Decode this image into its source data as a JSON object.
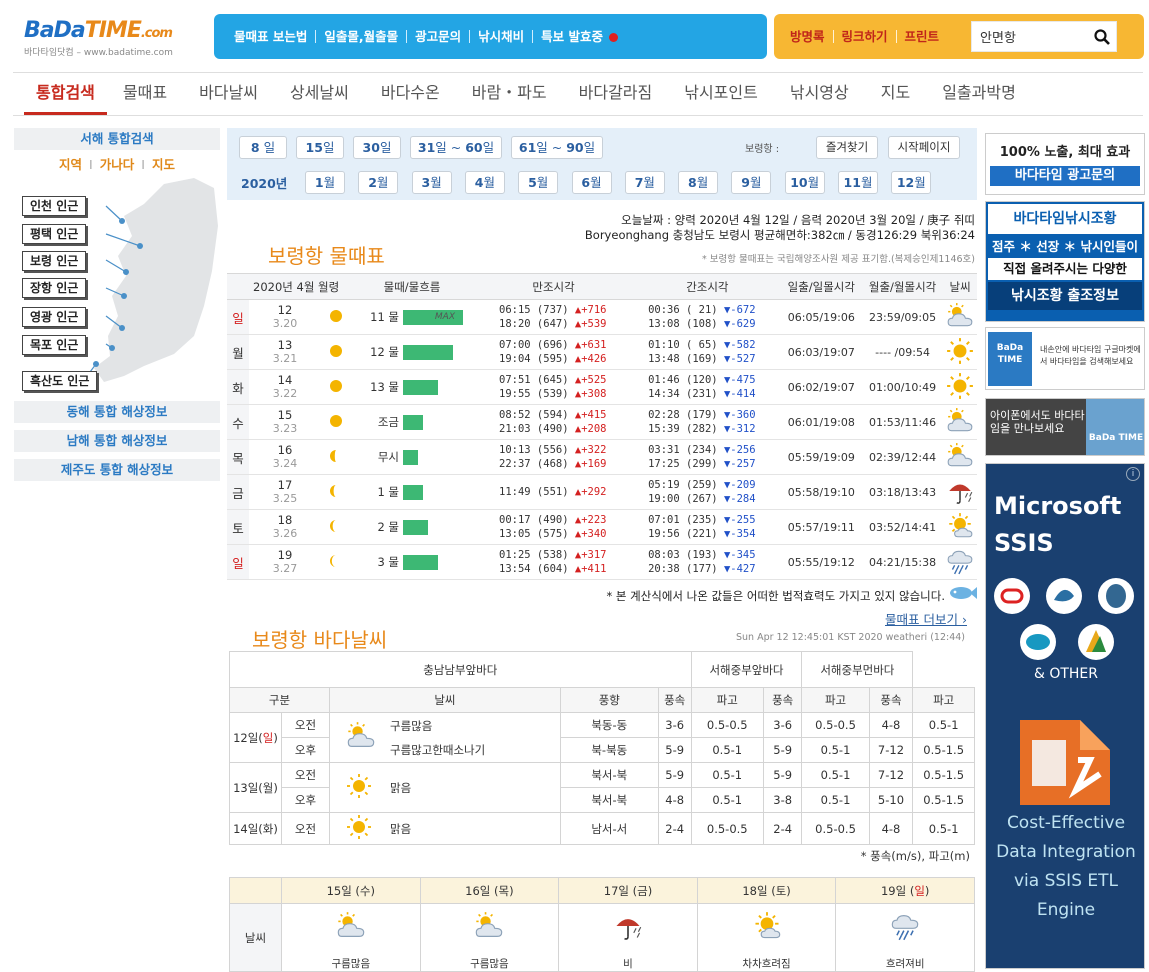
{
  "header": {
    "logo_main": "BaDa",
    "logo_time": "TIME",
    "logo_com": ".com",
    "logo_sub": "바다타임닷컴 – www.badatime.com",
    "topnav": [
      "물때표 보는법",
      "일출몰,월출몰",
      "광고문의",
      "낚시채비",
      "특보 발효중"
    ],
    "topright": [
      "방명록",
      "링크하기",
      "프린트"
    ],
    "search_value": "안면항"
  },
  "tabs": [
    "통합검색",
    "물때표",
    "바다날씨",
    "상세날씨",
    "바다수온",
    "바람・파도",
    "바다갈라짐",
    "낚시포인트",
    "낚시영상",
    "지도",
    "일출과박명"
  ],
  "sidebar": {
    "head": "서해 통합검색",
    "sub": [
      "지역",
      "가나다",
      "지도"
    ],
    "regions": [
      "인천 인근",
      "평택 인근",
      "보령 인근",
      "장항 인근",
      "영광 인근",
      "목포 인근",
      "흑산도 인근"
    ],
    "buttons": [
      "동해 통합 해상정보",
      "남해 통합 해상정보",
      "제주도 통합 해상정보"
    ]
  },
  "datebar": {
    "ranges": [
      {
        "n": "8",
        "u": " 일"
      },
      {
        "n": "15",
        "u": "일"
      },
      {
        "n": "30",
        "u": "일"
      },
      {
        "n": "31",
        "u": "일 ~ ",
        "n2": "60",
        "u2": "일"
      },
      {
        "n": "61",
        "u": "일 ~ ",
        "n2": "90",
        "u2": "일"
      }
    ],
    "label": "보령항 :",
    "fav": "즐겨찾기",
    "start": "시작페이지",
    "year": "2020년",
    "months": [
      "1",
      "2",
      "3",
      "4",
      "5",
      "6",
      "7",
      "8",
      "9",
      "10",
      "11",
      "12"
    ],
    "month_unit": "월"
  },
  "today": {
    "line1": "오늘날짜 : 양력 2020년 4월 12일 / 음력 2020년 3월 20일 / 庚子 쥐띠",
    "line2": "Boryeonghang 충청남도 보령시 평균해면하:382㎝ / 동경126:29 북위36:24",
    "source": "* 보령항 물때표는 국립해양조사원 제공 표기함.(복제승인제1146호)"
  },
  "tide": {
    "title": "보령항 물때표",
    "headers": [
      "2020년  4월 월령",
      "물때/물흐름",
      "만조시각",
      "간조시각",
      "일출/일몰시각",
      "월출/월몰시각",
      "날씨"
    ],
    "rows": [
      {
        "dow": "일",
        "d": "12",
        "l": "3.20",
        "mul": "11 물",
        "bar": 0.86,
        "max": "MAX",
        "hi": [
          [
            "06:15 (737)",
            "+716"
          ],
          [
            "18:20 (647)",
            "+539"
          ]
        ],
        "lo": [
          [
            "00:36 ( 21)",
            "-672"
          ],
          [
            "13:08 (108)",
            "-629"
          ]
        ],
        "sun": "06:05/19:06",
        "moon": "23:59/09:05",
        "w": "cloudy"
      },
      {
        "dow": "월",
        "d": "13",
        "l": "3.21",
        "mul": "12 물",
        "bar": 0.71,
        "hi": [
          [
            "07:00 (696)",
            "+631"
          ],
          [
            "19:04 (595)",
            "+426"
          ]
        ],
        "lo": [
          [
            "01:10 ( 65)",
            "-582"
          ],
          [
            "13:48 (169)",
            "-527"
          ]
        ],
        "sun": "06:03/19:07",
        "moon": "---- /09:54",
        "w": "sun"
      },
      {
        "dow": "화",
        "d": "14",
        "l": "3.22",
        "mul": "13 물",
        "bar": 0.5,
        "hi": [
          [
            "07:51 (645)",
            "+525"
          ],
          [
            "19:55 (539)",
            "+308"
          ]
        ],
        "lo": [
          [
            "01:46 (120)",
            "-475"
          ],
          [
            "14:34 (231)",
            "-414"
          ]
        ],
        "sun": "06:02/19:07",
        "moon": "01:00/10:49",
        "w": "sun"
      },
      {
        "dow": "수",
        "d": "15",
        "l": "3.23",
        "mul": "조금",
        "bar": 0.29,
        "hi": [
          [
            "08:52 (594)",
            "+415"
          ],
          [
            "21:03 (490)",
            "+208"
          ]
        ],
        "lo": [
          [
            "02:28 (179)",
            "-360"
          ],
          [
            "15:39 (282)",
            "-312"
          ]
        ],
        "sun": "06:01/19:08",
        "moon": "01:53/11:46",
        "w": "cloudy"
      },
      {
        "dow": "목",
        "d": "16",
        "l": "3.24",
        "mul": "무시",
        "bar": 0.21,
        "hi": [
          [
            "10:13 (556)",
            "+322"
          ],
          [
            "22:37 (468)",
            "+169"
          ]
        ],
        "lo": [
          [
            "03:31 (234)",
            "-256"
          ],
          [
            "17:25 (299)",
            "-257"
          ]
        ],
        "sun": "05:59/19:09",
        "moon": "02:39/12:44",
        "w": "cloudy"
      },
      {
        "dow": "금",
        "d": "17",
        "l": "3.25",
        "mul": "1 물",
        "bar": 0.29,
        "hi": [
          [
            "11:49 (551)",
            "+292"
          ]
        ],
        "lo": [
          [
            "05:19 (259)",
            "-209"
          ],
          [
            "19:00 (267)",
            "-284"
          ]
        ],
        "sun": "05:58/19:10",
        "moon": "03:18/13:43",
        "w": "rain"
      },
      {
        "dow": "토",
        "d": "18",
        "l": "3.26",
        "mul": "2 물",
        "bar": 0.36,
        "hi": [
          [
            "00:17 (490)",
            "+223"
          ],
          [
            "13:05 (575)",
            "+340"
          ]
        ],
        "lo": [
          [
            "07:01 (235)",
            "-255"
          ],
          [
            "19:56 (221)",
            "-354"
          ]
        ],
        "sun": "05:57/19:11",
        "moon": "03:52/14:41",
        "w": "partly"
      },
      {
        "dow": "일",
        "d": "19",
        "l": "3.27",
        "mul": "3 물",
        "bar": 0.5,
        "hi": [
          [
            "01:25 (538)",
            "+317"
          ],
          [
            "13:54 (604)",
            "+411"
          ]
        ],
        "lo": [
          [
            "08:03 (193)",
            "-345"
          ],
          [
            "20:38 (177)",
            "-427"
          ]
        ],
        "sun": "05:55/19:12",
        "moon": "04:21/15:38",
        "w": "shower"
      }
    ],
    "disclaimer": "* 본 계산식에서 나온 값들은 어떠한 법적효력도 가지고 있지 않습니다.",
    "more": "물때표 더보기"
  },
  "weather": {
    "title": "보령항 바다날씨",
    "stamp": "Sun Apr 12 12:45:01 KST 2020 weatheri (12:44)",
    "areas": [
      "충남남부앞바다",
      "서해중부앞바다",
      "서해중부먼바다"
    ],
    "cols": [
      "구분",
      "날씨",
      "풍향",
      "풍속",
      "파고",
      "풍속",
      "파고",
      "풍속",
      "파고"
    ],
    "days": [
      {
        "day": "12일(",
        "dow": "일",
        "close": ")",
        "rows": [
          {
            "p": "오전",
            "desc": "구름많음",
            "dir": "북동-동",
            "a": [
              "3-6",
              "0.5-0.5",
              "3-6",
              "0.5-0.5",
              "4-8",
              "0.5-1"
            ]
          },
          {
            "p": "오후",
            "desc": "구름많고한때소나기",
            "dir": "북-북동",
            "a": [
              "5-9",
              "0.5-1",
              "5-9",
              "0.5-1",
              "7-12",
              "0.5-1.5"
            ]
          }
        ]
      },
      {
        "day": "13일(",
        "dow": "월",
        "close": ")",
        "rows": [
          {
            "p": "오전",
            "desc": "맑음",
            "dir": "북서-북",
            "a": [
              "5-9",
              "0.5-1",
              "5-9",
              "0.5-1",
              "7-12",
              "0.5-1.5"
            ]
          },
          {
            "p": "오후",
            "desc": "",
            "dir": "북서-북",
            "a": [
              "4-8",
              "0.5-1",
              "3-8",
              "0.5-1",
              "5-10",
              "0.5-1.5"
            ]
          }
        ]
      },
      {
        "day": "14일(",
        "dow": "화",
        "close": ")",
        "rows": [
          {
            "p": "오전",
            "desc": "맑음",
            "dir": "남서-서",
            "a": [
              "2-4",
              "0.5-0.5",
              "2-4",
              "0.5-0.5",
              "4-8",
              "0.5-1"
            ]
          }
        ]
      }
    ],
    "note": "* 풍속(m/s), 파고(m)",
    "week_label": "날씨",
    "week": [
      {
        "d": "15일 (",
        "dow": "수",
        "c": ")",
        "desc": "구름많음",
        "w": "cloudy"
      },
      {
        "d": "16일 (",
        "dow": "목",
        "c": ")",
        "desc": "구름많음",
        "w": "cloudy"
      },
      {
        "d": "17일 (",
        "dow": "금",
        "c": ")",
        "desc": "비",
        "w": "rain"
      },
      {
        "d": "18일 (",
        "dow": "토",
        "c": ")",
        "desc": "차차흐려짐",
        "w": "partly"
      },
      {
        "d": "19일 (",
        "dow": "일",
        "c": ")",
        "desc": "흐려져비",
        "w": "shower"
      }
    ]
  },
  "ads": {
    "a1_l1": "100% 노출, 최대 효과",
    "a1_l2": "바다타임 광고문의",
    "a2_l1": "바다타임낚시조황",
    "a2_l2": "점주 ＊ 선장 ＊ 낚시인들이",
    "a2_l3": "직접 올려주시는 다양한",
    "a2_l4": "낚시조황 출조정보",
    "a3_logo": "BaDa TIME",
    "a3_text": "내손안에 바다타임 구글마켓에서 바다타임을 검색해보세요",
    "a4_text": "아이폰에서도 바다타임을 만나보세요",
    "a4_logo": "BaDa TIME",
    "a5_title": "Microsoft SSIS",
    "a5_other": "& OTHER",
    "a5_tag": "Cost-Effective Data Integration via SSIS ETL Engine"
  }
}
